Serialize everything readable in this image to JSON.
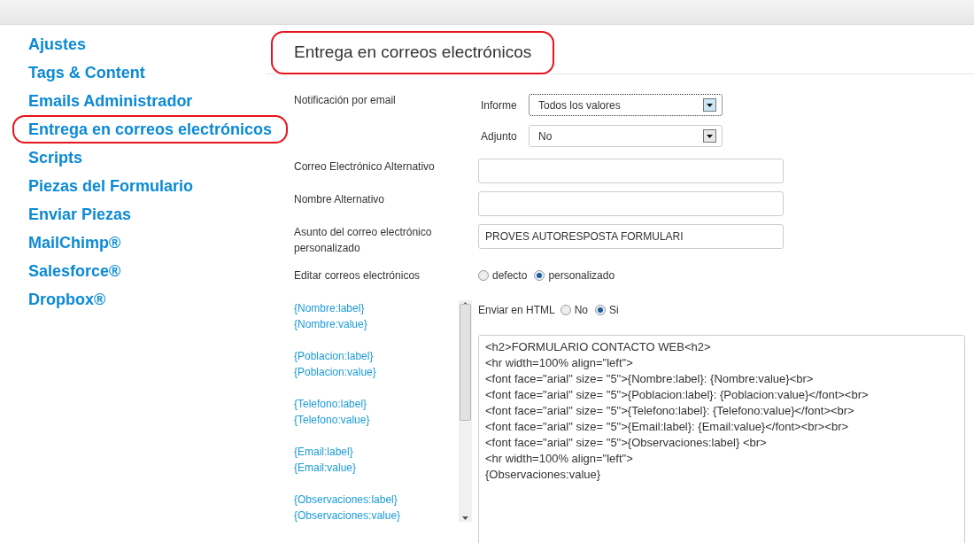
{
  "sidebar": {
    "items": [
      {
        "label": "Ajustes",
        "circled": false
      },
      {
        "label": "Tags & Content",
        "circled": false
      },
      {
        "label": "Emails Administrador",
        "circled": false
      },
      {
        "label": "Entrega en correos electrónicos",
        "circled": true
      },
      {
        "label": "Scripts",
        "circled": false
      },
      {
        "label": "Piezas del Formulario",
        "circled": false
      },
      {
        "label": "Enviar Piezas",
        "circled": false
      },
      {
        "label": "MailChimp®",
        "circled": false
      },
      {
        "label": "Salesforce®",
        "circled": false
      },
      {
        "label": "Dropbox®",
        "circled": false
      }
    ]
  },
  "title": {
    "text": "Entrega en correos electrónicos",
    "circled": true
  },
  "notification": {
    "label": "Notificación por email",
    "selects": [
      {
        "label": "Informe",
        "value": "Todos los valores",
        "focused": true
      },
      {
        "label": "Adjunto",
        "value": "No",
        "focused": false
      }
    ]
  },
  "fields": [
    {
      "label": "Correo Electrónico Alternativo"
    },
    {
      "label": "Nombre Alternativo"
    },
    {
      "label": "Asunto del correo electrónico personalizado",
      "value": "PROVES AUTORESPOSTA FORMULARI"
    }
  ],
  "edit_emails": {
    "label": "Editar correos electrónicos",
    "options": [
      {
        "label": "defecto",
        "selected": false
      },
      {
        "label": "personalizado",
        "selected": true
      }
    ]
  },
  "tags": [
    "{Nombre:label}",
    "{Nombre:value}",
    "{Poblacion:label}",
    "{Poblacion:value}",
    "{Telefono:label}",
    "{Telefono:value}",
    "{Email:label}",
    "{Email:value}",
    "{Observaciones:label}",
    "{Observaciones:value}"
  ],
  "send_html": {
    "label": "Enviar en HTML",
    "options": [
      {
        "label": "No",
        "selected": false
      },
      {
        "label": "Si",
        "selected": true
      }
    ]
  },
  "body": {
    "lines": [
      "<h2>FORMULARIO CONTACTO WEB<h2>",
      "<hr width=100% align=\"left\">",
      "<font face=\"arial\" size= \"5\">{Nombre:label}: {Nombre:value}<br>",
      "<font face=\"arial\" size= \"5\">{Poblacion:label}: {Poblacion:value}</font><br>",
      "<font face=\"arial\" size= \"5\">{Telefono:label}: {Telefono:value}</font><br>",
      "<font face=\"arial\" size= \"5\">{Email:label}: {Email:value}</font><br><br>",
      "<font face=\"arial\" size= \"5\">{Observaciones:label} <br>",
      "<hr width=100% align=\"left\">",
      "{Observaciones:value}"
    ]
  }
}
